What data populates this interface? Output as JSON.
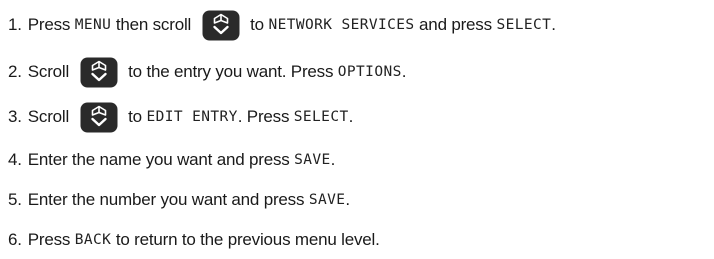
{
  "steps": [
    {
      "number": "1.",
      "segments": [
        {
          "kind": "text",
          "value": "Press "
        },
        {
          "kind": "lcd",
          "value": "MENU"
        },
        {
          "kind": "text",
          "value": " then scroll "
        },
        {
          "kind": "icon",
          "value": "navigation-key-icon"
        },
        {
          "kind": "text",
          "value": " to "
        },
        {
          "kind": "lcd",
          "value": "NETWORK SERVICES"
        },
        {
          "kind": "text",
          "value": " and press "
        },
        {
          "kind": "lcd",
          "value": "SELECT"
        },
        {
          "kind": "text",
          "value": "."
        }
      ]
    },
    {
      "number": "2.",
      "segments": [
        {
          "kind": "text",
          "value": "Scroll "
        },
        {
          "kind": "icon",
          "value": "navigation-key-icon"
        },
        {
          "kind": "text",
          "value": " to the entry you want. Press "
        },
        {
          "kind": "lcd",
          "value": "OPTIONS"
        },
        {
          "kind": "text",
          "value": "."
        }
      ]
    },
    {
      "number": "3.",
      "segments": [
        {
          "kind": "text",
          "value": "Scroll "
        },
        {
          "kind": "icon",
          "value": "navigation-key-icon"
        },
        {
          "kind": "text",
          "value": " to "
        },
        {
          "kind": "lcd",
          "value": "EDIT ENTRY"
        },
        {
          "kind": "text",
          "value": ". Press "
        },
        {
          "kind": "lcd",
          "value": "SELECT"
        },
        {
          "kind": "text",
          "value": "."
        }
      ]
    },
    {
      "number": "4.",
      "segments": [
        {
          "kind": "text",
          "value": "Enter the name you want and press "
        },
        {
          "kind": "lcd",
          "value": "SAVE"
        },
        {
          "kind": "text",
          "value": "."
        }
      ]
    },
    {
      "number": "5.",
      "segments": [
        {
          "kind": "text",
          "value": "Enter the number you want and press "
        },
        {
          "kind": "lcd",
          "value": "SAVE"
        },
        {
          "kind": "text",
          "value": "."
        }
      ]
    },
    {
      "number": "6.",
      "segments": [
        {
          "kind": "text",
          "value": "Press "
        },
        {
          "kind": "lcd",
          "value": "BACK"
        },
        {
          "kind": "text",
          "value": " to return to the previous menu level."
        }
      ]
    }
  ],
  "colors": {
    "nav_key_fill": "#2a2a2a",
    "nav_key_symbol": "#ffffff"
  }
}
